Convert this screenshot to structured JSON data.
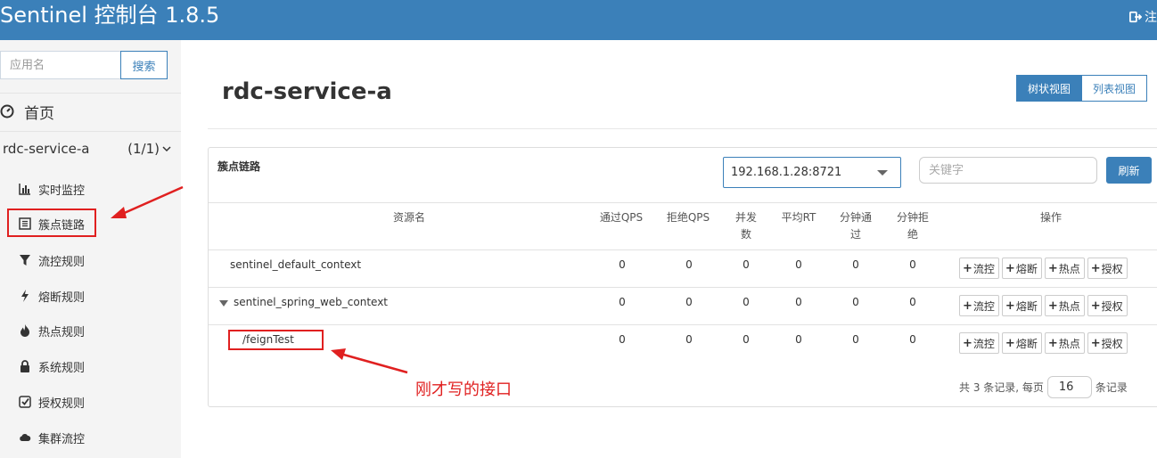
{
  "header": {
    "brand": "Sentinel 控制台 1.8.5",
    "logout_label": "注"
  },
  "sidebar": {
    "search": {
      "placeholder": "应用名",
      "button_label": "搜索"
    },
    "home_label": "首页",
    "app": {
      "name": "rdc-service-a",
      "count": "(1/1)"
    },
    "items": [
      {
        "label": "实时监控",
        "icon": "bar-chart-icon"
      },
      {
        "label": "簇点链路",
        "icon": "list-icon"
      },
      {
        "label": "流控规则",
        "icon": "filter-icon"
      },
      {
        "label": "熔断规则",
        "icon": "flash-icon"
      },
      {
        "label": "热点规则",
        "icon": "fire-icon"
      },
      {
        "label": "系统规则",
        "icon": "lock-icon"
      },
      {
        "label": "授权规则",
        "icon": "check-square-icon"
      },
      {
        "label": "集群流控",
        "icon": "cloud-icon"
      }
    ]
  },
  "main": {
    "title": "rdc-service-a",
    "view_tree_label": "树状视图",
    "view_list_label": "列表视图",
    "panel_title": "簇点链路",
    "machine_selected": "192.168.1.28:8721",
    "keyword_placeholder": "关键字",
    "refresh_label": "刷新",
    "columns": {
      "resource": "资源名",
      "pass_qps": "通过QPS",
      "block_qps": "拒绝QPS",
      "thread_1": "并发",
      "thread_2": "数",
      "avg_rt": "平均RT",
      "min_pass_1": "分钟通",
      "min_pass_2": "过",
      "min_block_1": "分钟拒",
      "min_block_2": "绝",
      "ops": "操作"
    },
    "rows": [
      {
        "resource": "sentinel_default_context",
        "pass_qps": "0",
        "block_qps": "0",
        "thread": "0",
        "avg_rt": "0",
        "min_pass": "0",
        "min_block": "0"
      },
      {
        "resource": "sentinel_spring_web_context",
        "pass_qps": "0",
        "block_qps": "0",
        "thread": "0",
        "avg_rt": "0",
        "min_pass": "0",
        "min_block": "0"
      },
      {
        "resource": "/feignTest",
        "pass_qps": "0",
        "block_qps": "0",
        "thread": "0",
        "avg_rt": "0",
        "min_pass": "0",
        "min_block": "0"
      }
    ],
    "op_buttons": {
      "flow": "流控",
      "degrade": "熔断",
      "hot": "热点",
      "auth": "授权"
    },
    "pager": {
      "prefix": "共 3 条记录, 每页",
      "page_size": "16",
      "suffix": "条记录"
    }
  },
  "annotation": {
    "text": "刚才写的接口",
    "color": "#e02020"
  },
  "colors": {
    "primary": "#3b80b9",
    "sidebar_bg": "#f4f4f4",
    "annotation": "#e02020"
  }
}
